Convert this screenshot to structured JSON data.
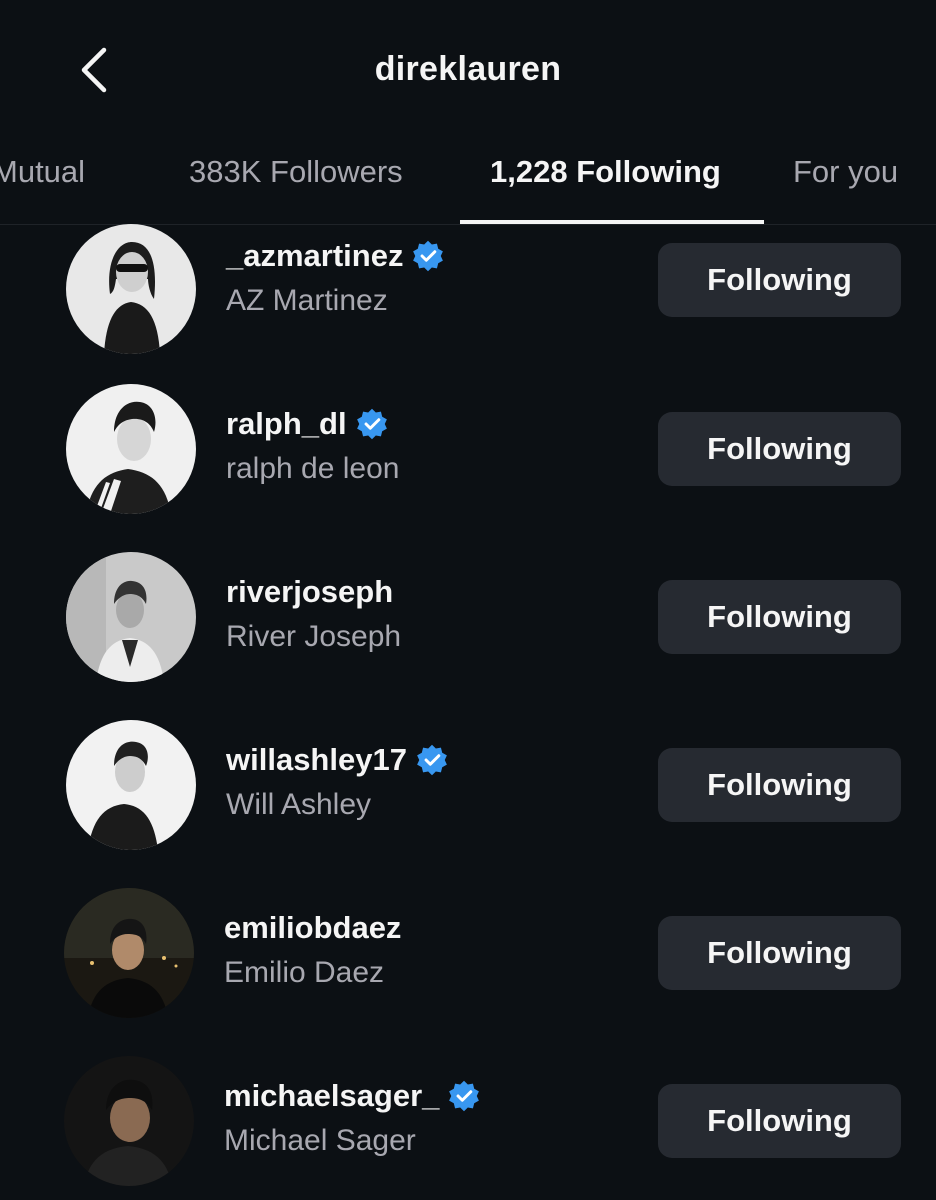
{
  "header": {
    "title": "direklauren",
    "back_icon": "chevron-left-icon"
  },
  "tabs": [
    {
      "label": "Mutual",
      "active": false
    },
    {
      "label": "383K Followers",
      "active": false
    },
    {
      "label": "1,228 Following",
      "active": true
    },
    {
      "label": "For you",
      "active": false
    }
  ],
  "accounts": [
    {
      "username": "_azmartinez",
      "name": "AZ Martinez",
      "verified": true,
      "button": "Following"
    },
    {
      "username": "ralph_dl",
      "name": "ralph de leon",
      "verified": true,
      "button": "Following"
    },
    {
      "username": "riverjoseph",
      "name": "River Joseph",
      "verified": false,
      "button": "Following"
    },
    {
      "username": "willashley17",
      "name": "Will Ashley",
      "verified": true,
      "button": "Following"
    },
    {
      "username": "emiliobdaez",
      "name": "Emilio Daez",
      "verified": false,
      "button": "Following"
    },
    {
      "username": "michaelsager_",
      "name": "Michael Sager",
      "verified": true,
      "button": "Following"
    }
  ],
  "colors": {
    "background": "#0c1014",
    "button": "#262a31",
    "verified": "#3897f0",
    "secondary_text": "#a8a8b0"
  }
}
